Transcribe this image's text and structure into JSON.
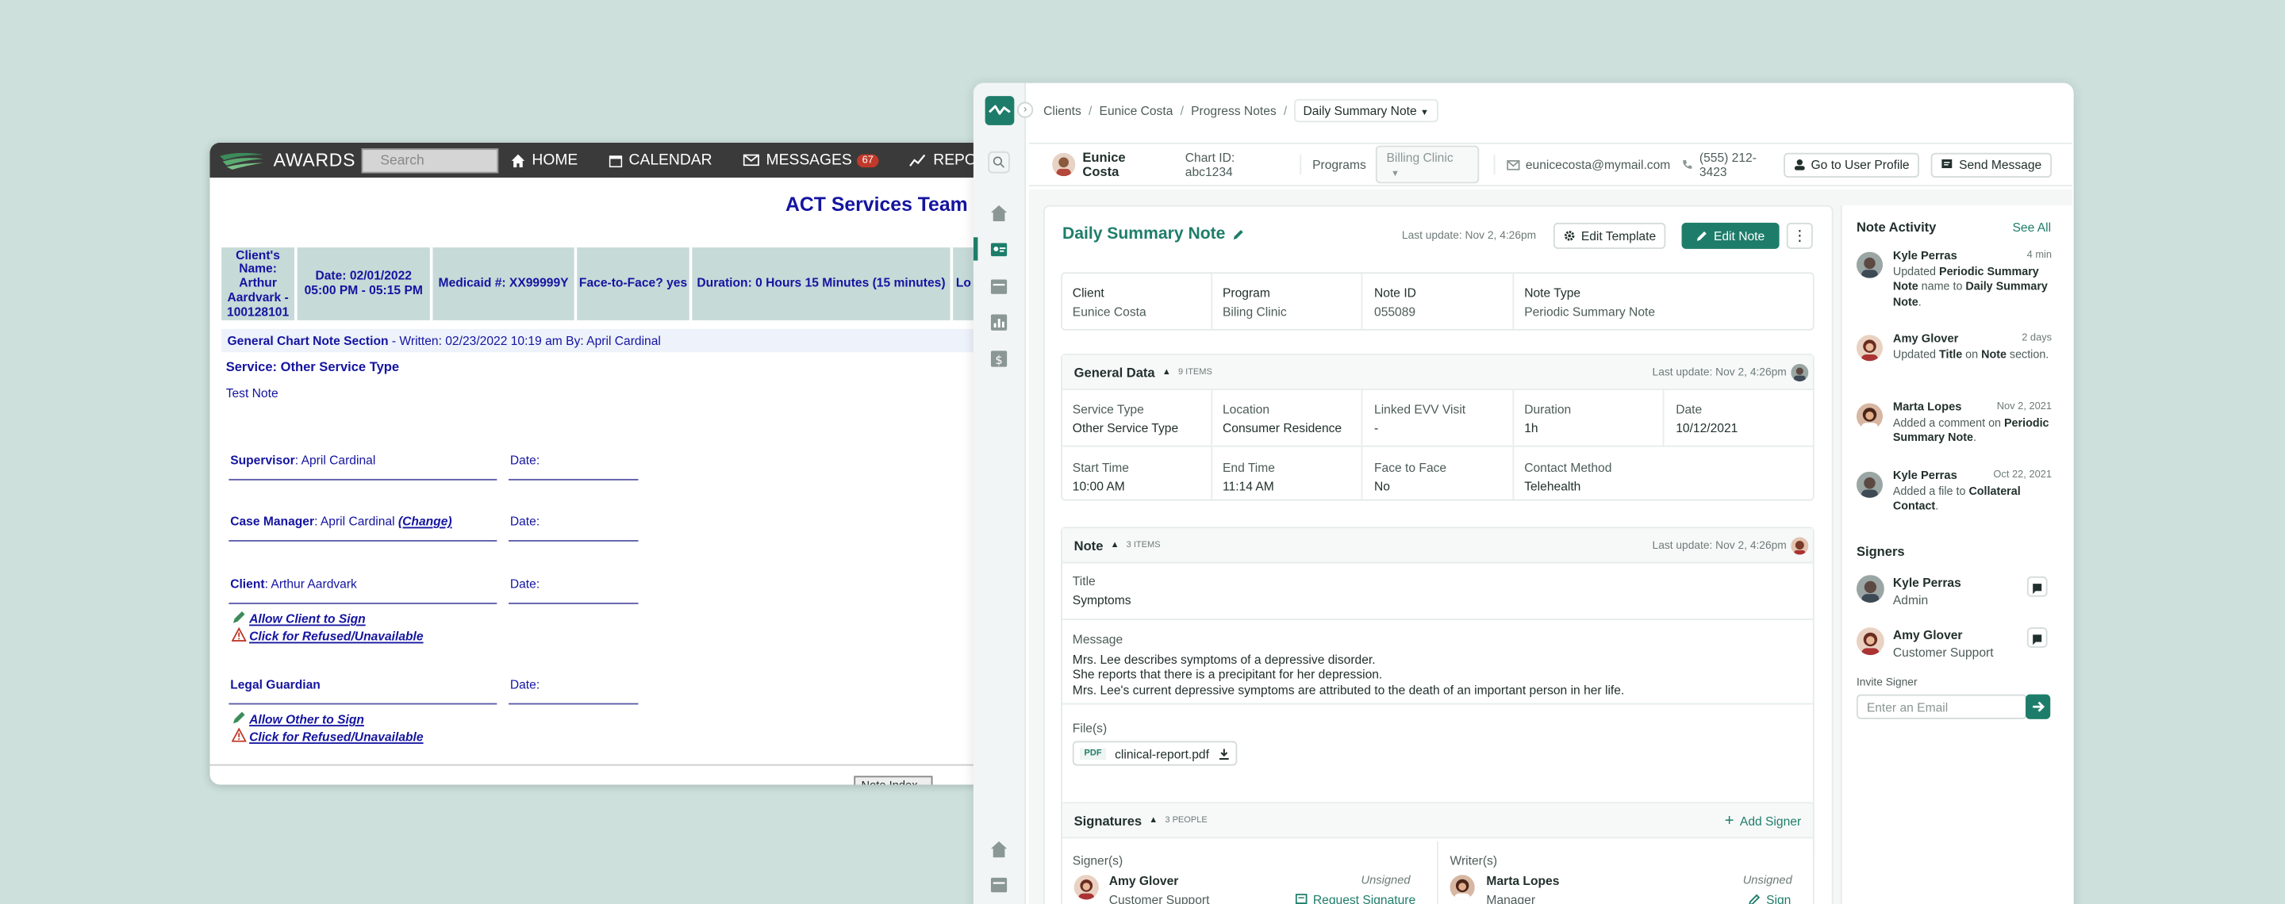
{
  "old_app": {
    "brand": "AWARDS",
    "search_placeholder": "Search",
    "nav": {
      "home": "HOME",
      "calendar": "CALENDAR",
      "messages": "MESSAGES",
      "messages_count": "67",
      "reports": "REPORTS"
    },
    "page_title": "ACT Services Team O",
    "header_cells": [
      "Client's\nName:\nArthur\nAardvark -\n100128101",
      "Date: 02/01/2022\n05:00 PM - 05:15 PM",
      "Medicaid #: XX99999Y",
      "Face-to-Face? yes",
      "Duration: 0 Hours 15 Minutes (15 minutes)",
      "Lo"
    ],
    "section_label": "General Chart Note Section",
    "section_meta": " - Written: 02/23/2022 10:19 am By: April Cardinal",
    "service_label": "Service: Other Service Type",
    "note_text": "Test Note",
    "supervisor_label": "Supervisor",
    "supervisor_name": ": April Cardinal",
    "case_manager_label": "Case Manager",
    "case_manager_name": ": April Cardinal ",
    "change_link": "(Change)",
    "client_label": "Client",
    "client_name": ": Arthur Aardvark",
    "legal_guardian_label": "Legal Guardian",
    "date_label": "Date:",
    "allow_client_sign": "Allow Client to Sign",
    "refused_unavailable": "Click for Refused/Unavailable",
    "allow_other_sign": "Allow Other to Sign",
    "bottom_button": "Note Index"
  },
  "new_app": {
    "breadcrumbs": [
      "Clients",
      "Eunice Costa",
      "Progress Notes"
    ],
    "breadcrumb_current": "Daily Summary Note",
    "client": {
      "name": "Eunice Costa",
      "chart_id": "Chart ID: abc1234",
      "programs_label": "Programs",
      "program_selected": "Billing Clinic",
      "email": "eunicecosta@mymail.com",
      "phone": "(555) 212-3423",
      "go_to_profile": "Go to User Profile",
      "send_message": "Send Message"
    },
    "note": {
      "title": "Daily Summary Note",
      "last_update": "Last update: Nov 2, 4:26pm",
      "edit_template": "Edit Template",
      "edit_note": "Edit Note",
      "summary": [
        {
          "label": "Client",
          "value": "Eunice Costa"
        },
        {
          "label": "Program",
          "value": "Biling Clinic"
        },
        {
          "label": "Note ID",
          "value": "055089"
        },
        {
          "label": "Note Type",
          "value": "Periodic Summary Note"
        }
      ]
    },
    "general_data": {
      "title": "General Data",
      "count": "9 ITEMS",
      "last_update": "Last update: Nov 2, 4:26pm",
      "row1": [
        {
          "label": "Service Type",
          "value": "Other Service Type"
        },
        {
          "label": "Location",
          "value": "Consumer Residence"
        },
        {
          "label": "Linked EVV Visit",
          "value": "-"
        },
        {
          "label": "Duration",
          "value": "1h"
        },
        {
          "label": "Date",
          "value": "10/12/2021"
        }
      ],
      "row2": [
        {
          "label": "Start Time",
          "value": "10:00 AM"
        },
        {
          "label": "End Time",
          "value": "11:14 AM"
        },
        {
          "label": "Face to Face",
          "value": "No"
        },
        {
          "label": "Contact Method",
          "value": "Telehealth"
        }
      ]
    },
    "note_section": {
      "title": "Note",
      "count": "3 ITEMS",
      "last_update": "Last update: Nov 2, 4:26pm",
      "title_label": "Title",
      "title_value": "Symptoms",
      "message_label": "Message",
      "message_lines": [
        "Mrs. Lee describes symptoms of a depressive disorder.",
        "She reports that there is a precipitant for her depression.",
        "Mrs. Lee's current depressive symptoms are attributed to the death of an important person in her life."
      ],
      "files_label": "File(s)",
      "file_type": "PDF",
      "file_name": "clinical-report.pdf"
    },
    "signatures": {
      "title": "Signatures",
      "count": "3 PEOPLE",
      "add_signer": "Add Signer",
      "signers_label": "Signer(s)",
      "writers_label": "Writer(s)",
      "signer": {
        "name": "Amy Glover",
        "role": "Customer Support",
        "status": "Unsigned",
        "action": "Request Signature"
      },
      "writer": {
        "name": "Marta Lopes",
        "role": "Manager",
        "status": "Unsigned",
        "action": "Sign"
      }
    },
    "activity": {
      "title": "Note Activity",
      "see_all": "See All",
      "items": [
        {
          "name": "Kyle Perras",
          "time": "4 min",
          "pre": "Updated ",
          "b1": "Periodic Summary Note",
          "mid": " name to ",
          "b2": "Daily Summary Note",
          "post": "."
        },
        {
          "name": "Amy Glover",
          "time": "2 days",
          "pre": "Updated ",
          "b1": "Title",
          "mid": " on ",
          "b2": "Note",
          "post": " section."
        },
        {
          "name": "Marta Lopes",
          "time": "Nov 2, 2021",
          "pre": "Added a comment on ",
          "b1": "Periodic Summary Note",
          "mid": "",
          "b2": "",
          "post": "."
        },
        {
          "name": "Kyle Perras",
          "time": "Oct 22, 2021",
          "pre": "Added a file to ",
          "b1": "Collateral Contact",
          "mid": "",
          "b2": "",
          "post": "."
        }
      ]
    },
    "signers_panel": {
      "title": "Signers",
      "items": [
        {
          "name": "Kyle Perras",
          "role": "Admin"
        },
        {
          "name": "Amy Glover",
          "role": "Customer Support"
        }
      ],
      "invite_label": "Invite Signer",
      "email_placeholder": "Enter an Email"
    }
  },
  "colors": {
    "brand_green": "#1e7d6a",
    "background": "#cde0dc",
    "old_blue": "#1414a0",
    "old_header": "#c6dad8"
  }
}
